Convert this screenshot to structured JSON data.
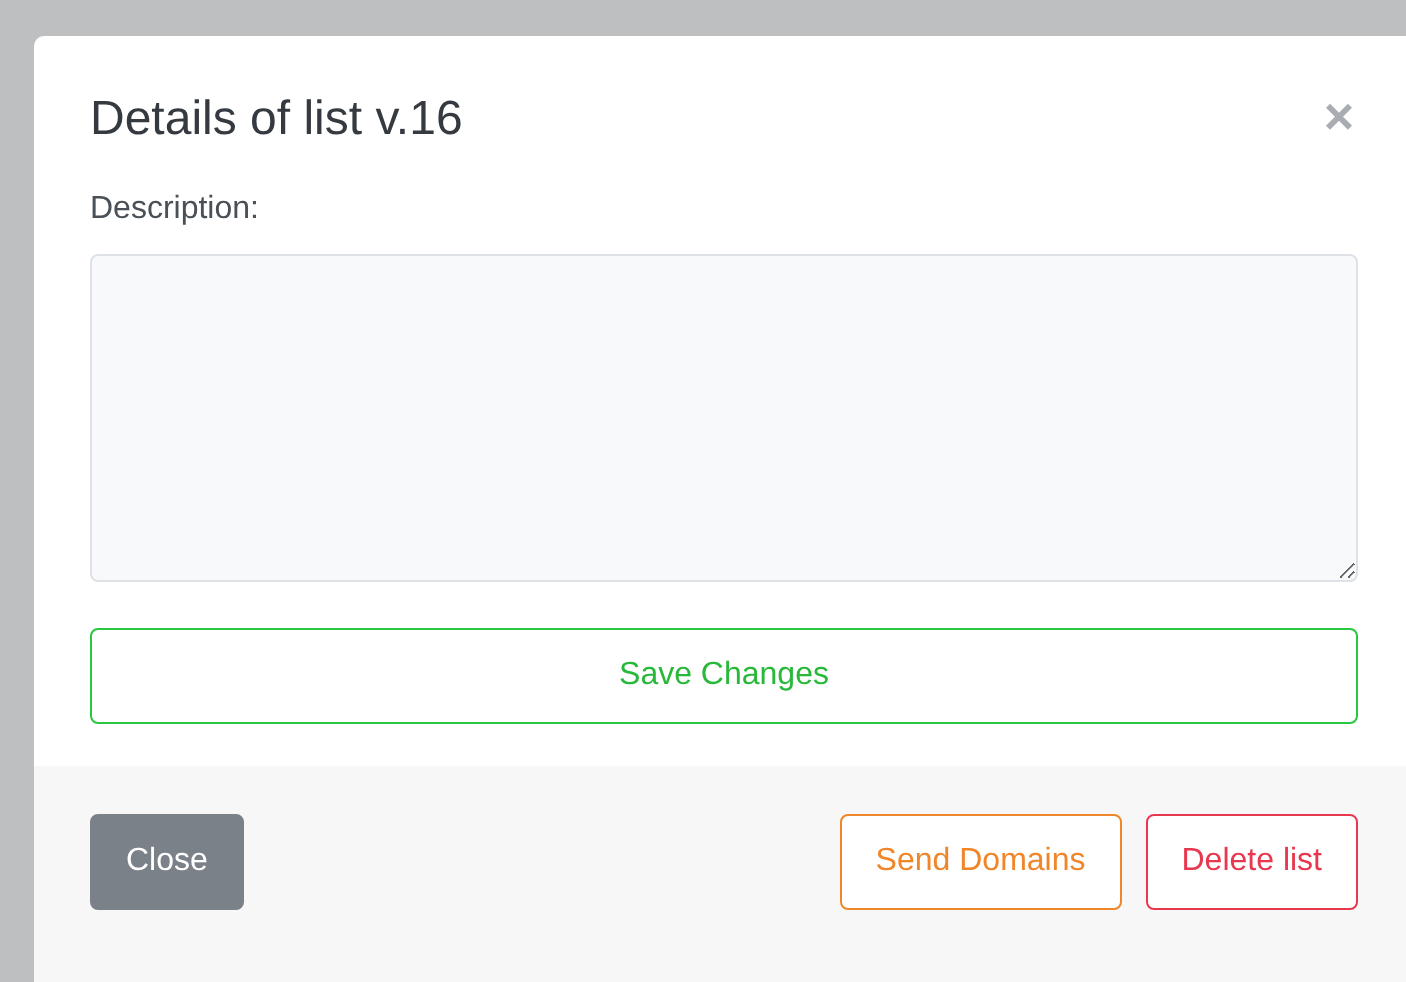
{
  "modal": {
    "title": "Details of list v.16",
    "close_icon": "×",
    "description": {
      "label": "Description:"
    },
    "save_button": "Save Changes",
    "footer_buttons": [
      {
        "label": "Close",
        "kind": "secondary"
      },
      {
        "label": "Send Domains",
        "kind": "warning"
      },
      {
        "label": "Delete list",
        "kind": "danger"
      }
    ]
  }
}
